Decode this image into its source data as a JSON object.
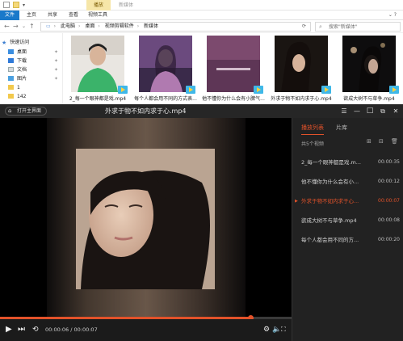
{
  "explorer": {
    "context_tab": "播放",
    "window_title": "新媒体",
    "ribbon_tabs": [
      "文件",
      "主页",
      "共享",
      "查看",
      "视频工具"
    ],
    "address": {
      "path": [
        "此电脑",
        "桌面",
        "视频剪辑软件",
        "新媒体"
      ]
    },
    "search": {
      "placeholder": "搜索\"新媒体\""
    },
    "nav": [
      {
        "label": "快速访问",
        "icon": "star-icon",
        "pinned": false
      },
      {
        "label": "桌面",
        "icon": "desktop-icon",
        "pinned": true
      },
      {
        "label": "下载",
        "icon": "download-icon",
        "pinned": true
      },
      {
        "label": "文档",
        "icon": "document-icon",
        "pinned": true
      },
      {
        "label": "图片",
        "icon": "picture-icon",
        "pinned": true
      },
      {
        "label": "1",
        "icon": "folder-icon",
        "pinned": false
      },
      {
        "label": "142",
        "icon": "folder-icon",
        "pinned": false
      }
    ],
    "files": [
      {
        "name": "2_每一个眼神都是戏.mp4",
        "thumb": "green"
      },
      {
        "name": "每个人都会用不同的方式表...",
        "thumb": "purple"
      },
      {
        "name": "他不懂你为什么会有小脾气...",
        "thumb": "pink"
      },
      {
        "name": "外求于物不如内求于心.mp4",
        "thumb": "dark"
      },
      {
        "name": "欲成大树不与草争.mp4",
        "thumb": "night"
      }
    ]
  },
  "player": {
    "open_home_label": "打开主界面",
    "title": "外求于物不如内求于心.mp4",
    "time": "00:00:06 / 00:00:07",
    "progress": 0.86,
    "playlist_tabs": [
      "播放列表",
      "片库"
    ],
    "playlist_count": "共5个视频",
    "playlist": [
      {
        "name": "2_每一个眼神都是戏.m...",
        "duration": "00:00:35",
        "playing": false
      },
      {
        "name": "他不懂你为什么会有小...",
        "duration": "00:00:12",
        "playing": false
      },
      {
        "name": "外求于物不如内求于心...",
        "duration": "00:00:07",
        "playing": true
      },
      {
        "name": "欲成大树不与草争.mp4",
        "duration": "00:00:08",
        "playing": false
      },
      {
        "name": "每个人都会用不同的方...",
        "duration": "00:00:20",
        "playing": false
      }
    ],
    "accent": "#e2522a"
  }
}
